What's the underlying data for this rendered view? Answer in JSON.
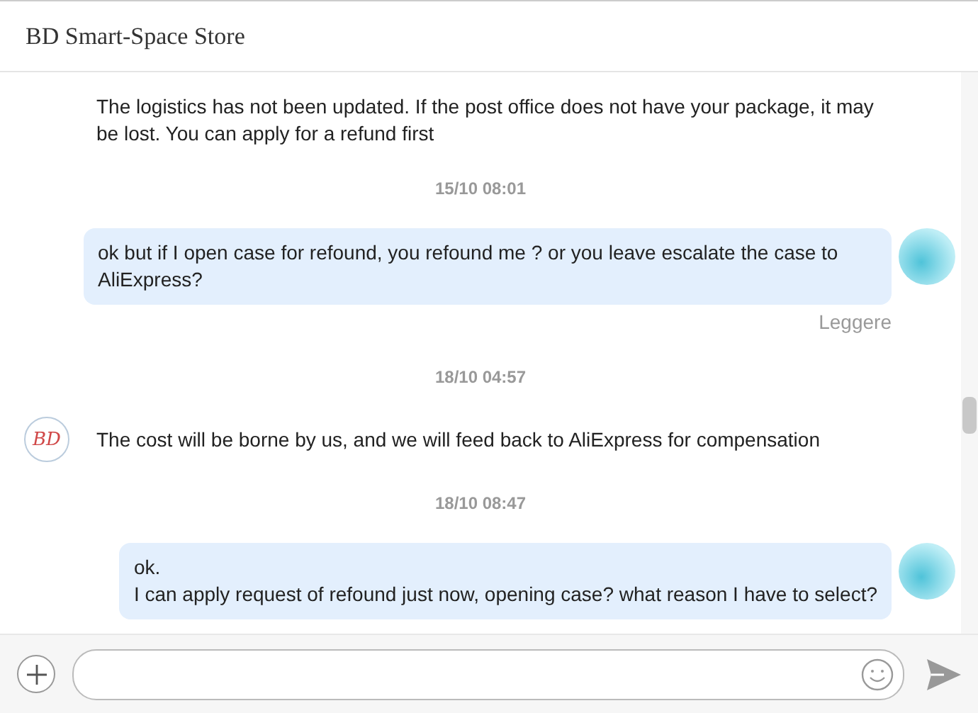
{
  "window": {
    "title": "BD Smart-Space Store"
  },
  "messages": [
    {
      "kind": "incoming",
      "show_avatar": false,
      "text": "The logistics has not been updated. If the post office does not have your package, it may be lost. You can apply for a refund first"
    },
    {
      "kind": "time",
      "text": "15/10 08:01"
    },
    {
      "kind": "outgoing",
      "show_avatar": true,
      "text": "ok but if I open case for refound, you refound me ? or you leave escalate the case to AliExpress?",
      "status": "Leggere"
    },
    {
      "kind": "time",
      "text": "18/10 04:57"
    },
    {
      "kind": "incoming",
      "show_avatar": true,
      "avatar_text": "BD",
      "text": "The cost will be borne by us, and we will feed back to AliExpress for compensation"
    },
    {
      "kind": "time",
      "text": "18/10 08:47"
    },
    {
      "kind": "outgoing",
      "show_avatar": true,
      "text": "ok.\nI can apply request of refound just now, opening case? what reason I have to select?"
    }
  ]
}
